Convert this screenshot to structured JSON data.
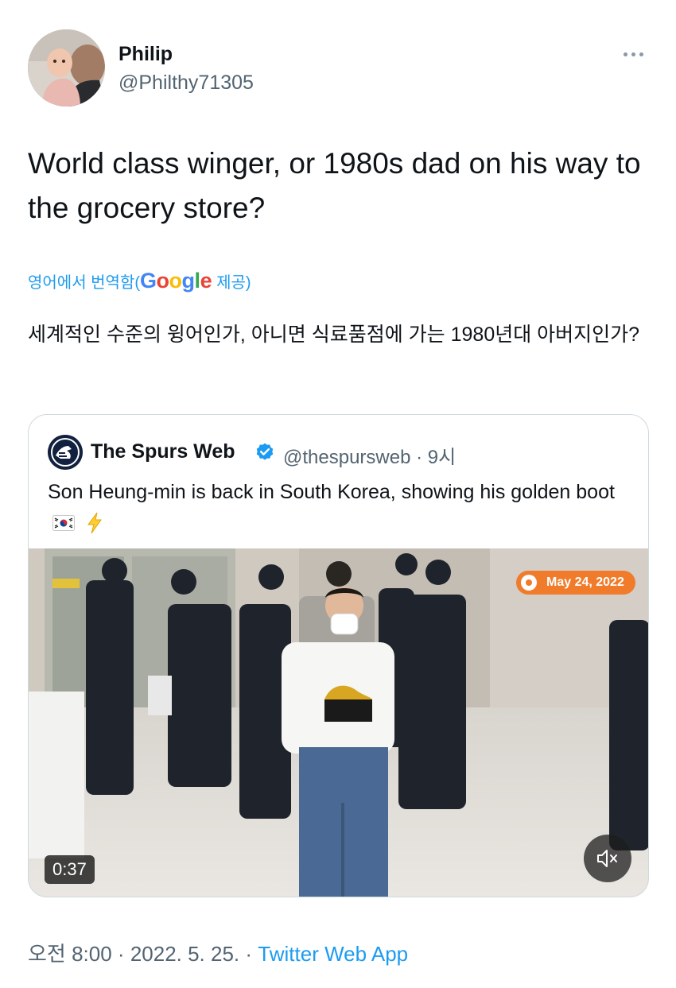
{
  "author": {
    "name": "Philip",
    "handle": "@Philthy71305"
  },
  "tweet": {
    "text": "World class winger, or 1980s dad on his way to the grocery store?"
  },
  "translation": {
    "prefix": "영어에서 번역함(",
    "google": [
      "G",
      "o",
      "o",
      "g",
      "l",
      "e"
    ],
    "suffix": "제공)",
    "text": "세계적인 수준의 윙어인가, 아니면 식료품점에 가는 1980년대 아버지인가?"
  },
  "quoted_tweet": {
    "name": "The Spurs Web",
    "handle": "@thespursweb",
    "separator": "·",
    "time": "9시",
    "text": "Son Heung-min is back in South Korea, showing his golden boot",
    "emojis": [
      "flag-south-korea-icon",
      "high-voltage-icon"
    ],
    "video": {
      "date_badge": "May 24, 2022",
      "duration": "0:37",
      "muted": true
    }
  },
  "footer": {
    "time": "오전 8:00",
    "separator": "·",
    "date": "2022. 5. 25.",
    "source": "Twitter Web App"
  },
  "colors": {
    "accent": "#1d9bf0",
    "secondary_text": "#536471",
    "primary_text": "#0f1419",
    "border": "#cfd9de",
    "date_badge": "#f07b2a"
  }
}
